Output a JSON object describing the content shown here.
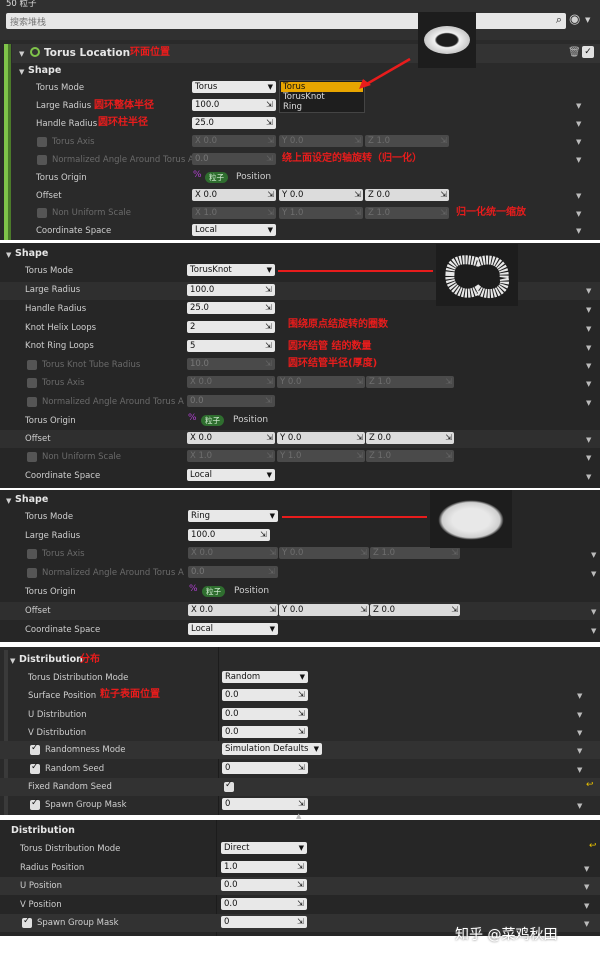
{
  "topbar": {
    "title": "50 粒子",
    "search_placeholder": "搜索堆栈"
  },
  "location": {
    "title": "Torus Location",
    "title_note": "环面位置",
    "shape_header": "Shape",
    "rows": {
      "torus_mode": "Torus Mode",
      "large_radius": "Large Radius",
      "large_radius_note": "圆环整体半径",
      "large_radius_value": "100.0",
      "handle_radius": "Handle Radius",
      "handle_radius_note": "圆环柱半径",
      "handle_radius_value": "25.0",
      "torus_axis": "Torus Axis",
      "normalized_angle": "Normalized Angle Around Torus A",
      "normalized_value": "0.0",
      "axis_note": "绕上面设定的轴旋转（归一化）",
      "torus_origin": "Torus Origin",
      "origin_pill": "粒子",
      "origin_value": "Position",
      "offset": "Offset",
      "non_uniform": "Non Uniform Scale",
      "scale_note": "归一化统一缩放",
      "coordinate_space": "Coordinate Space",
      "coordinate_value": "Local"
    },
    "mode_selected": "Torus",
    "dropdown_options": [
      "Torus",
      "TorusKnot",
      "Ring"
    ],
    "axis": {
      "x": "X 0.0",
      "y": "Y 0.0",
      "z": "Z 1.0"
    },
    "offset": {
      "x": "X 0.0",
      "y": "Y 0.0",
      "z": "Z 0.0"
    },
    "scale": {
      "x": "X 1.0",
      "y": "Y 1.0",
      "z": "Z 1.0"
    }
  },
  "knot": {
    "shape_header": "Shape",
    "torus_mode": "Torus Mode",
    "mode_value": "TorusKnot",
    "large_radius": "Large Radius",
    "large_radius_value": "100.0",
    "handle_radius": "Handle Radius",
    "handle_radius_value": "25.0",
    "helix_loops": "Knot Helix Loops",
    "helix_value": "2",
    "helix_note": "围绕原点结旋转的圈数",
    "ring_loops": "Knot Ring Loops",
    "ring_value": "5",
    "ring_note": "圆环结管 结的数量",
    "tube_radius": "Torus Knot Tube Radius",
    "tube_value": "10.0",
    "tube_note": "圆环结管半径(厚度)",
    "torus_axis": "Torus Axis",
    "normalized_angle": "Normalized Angle Around Torus A",
    "normalized_value": "0.0",
    "torus_origin": "Torus Origin",
    "origin_pill": "粒子",
    "origin_value": "Position",
    "offset": "Offset",
    "non_uniform": "Non Uniform Scale",
    "coordinate_space": "Coordinate Space",
    "coordinate_value": "Local",
    "axis": {
      "x": "X 0.0",
      "y": "Y 0.0",
      "z": "Z 1.0"
    },
    "offset_v": {
      "x": "X 0.0",
      "y": "Y 0.0",
      "z": "Z 0.0"
    },
    "scale": {
      "x": "X 1.0",
      "y": "Y 1.0",
      "z": "Z 1.0"
    }
  },
  "ring": {
    "shape_header": "Shape",
    "torus_mode": "Torus Mode",
    "mode_value": "Ring",
    "large_radius": "Large Radius",
    "large_radius_value": "100.0",
    "torus_axis": "Torus Axis",
    "normalized_angle": "Normalized Angle Around Torus A",
    "normalized_value": "0.0",
    "torus_origin": "Torus Origin",
    "origin_pill": "粒子",
    "origin_value": "Position",
    "offset": "Offset",
    "coordinate_space": "Coordinate Space",
    "coordinate_value": "Local",
    "axis": {
      "x": "X 0.0",
      "y": "Y 0.0",
      "z": "Z 1.0"
    },
    "offset_v": {
      "x": "X 0.0",
      "y": "Y 0.0",
      "z": "Z 0.0"
    }
  },
  "dist1": {
    "header": "Distribution",
    "header_note": "分布",
    "mode_label": "Torus Distribution Mode",
    "mode_value": "Random",
    "surface": "Surface Position",
    "surface_note": "粒子表面位置",
    "surface_value": "0.0",
    "u_dist": "U Distribution",
    "u_value": "0.0",
    "v_dist": "V Distribution",
    "v_value": "0.0",
    "rand_mode": "Randomness Mode",
    "rand_mode_value": "Simulation Defaults",
    "rand_seed": "Random Seed",
    "rand_seed_value": "0",
    "fixed_seed": "Fixed Random Seed",
    "spawn_mask": "Spawn Group Mask",
    "spawn_value": "0"
  },
  "dist2": {
    "header": "Distribution",
    "mode_label": "Torus Distribution Mode",
    "mode_value": "Direct",
    "radius_pos": "Radius Position",
    "radius_value": "1.0",
    "u_pos": "U Position",
    "u_value": "0.0",
    "v_pos": "V Position",
    "v_value": "0.0",
    "spawn_mask": "Spawn Group Mask",
    "spawn_value": "0"
  },
  "watermark": "知乎 @菜鸡秋田"
}
